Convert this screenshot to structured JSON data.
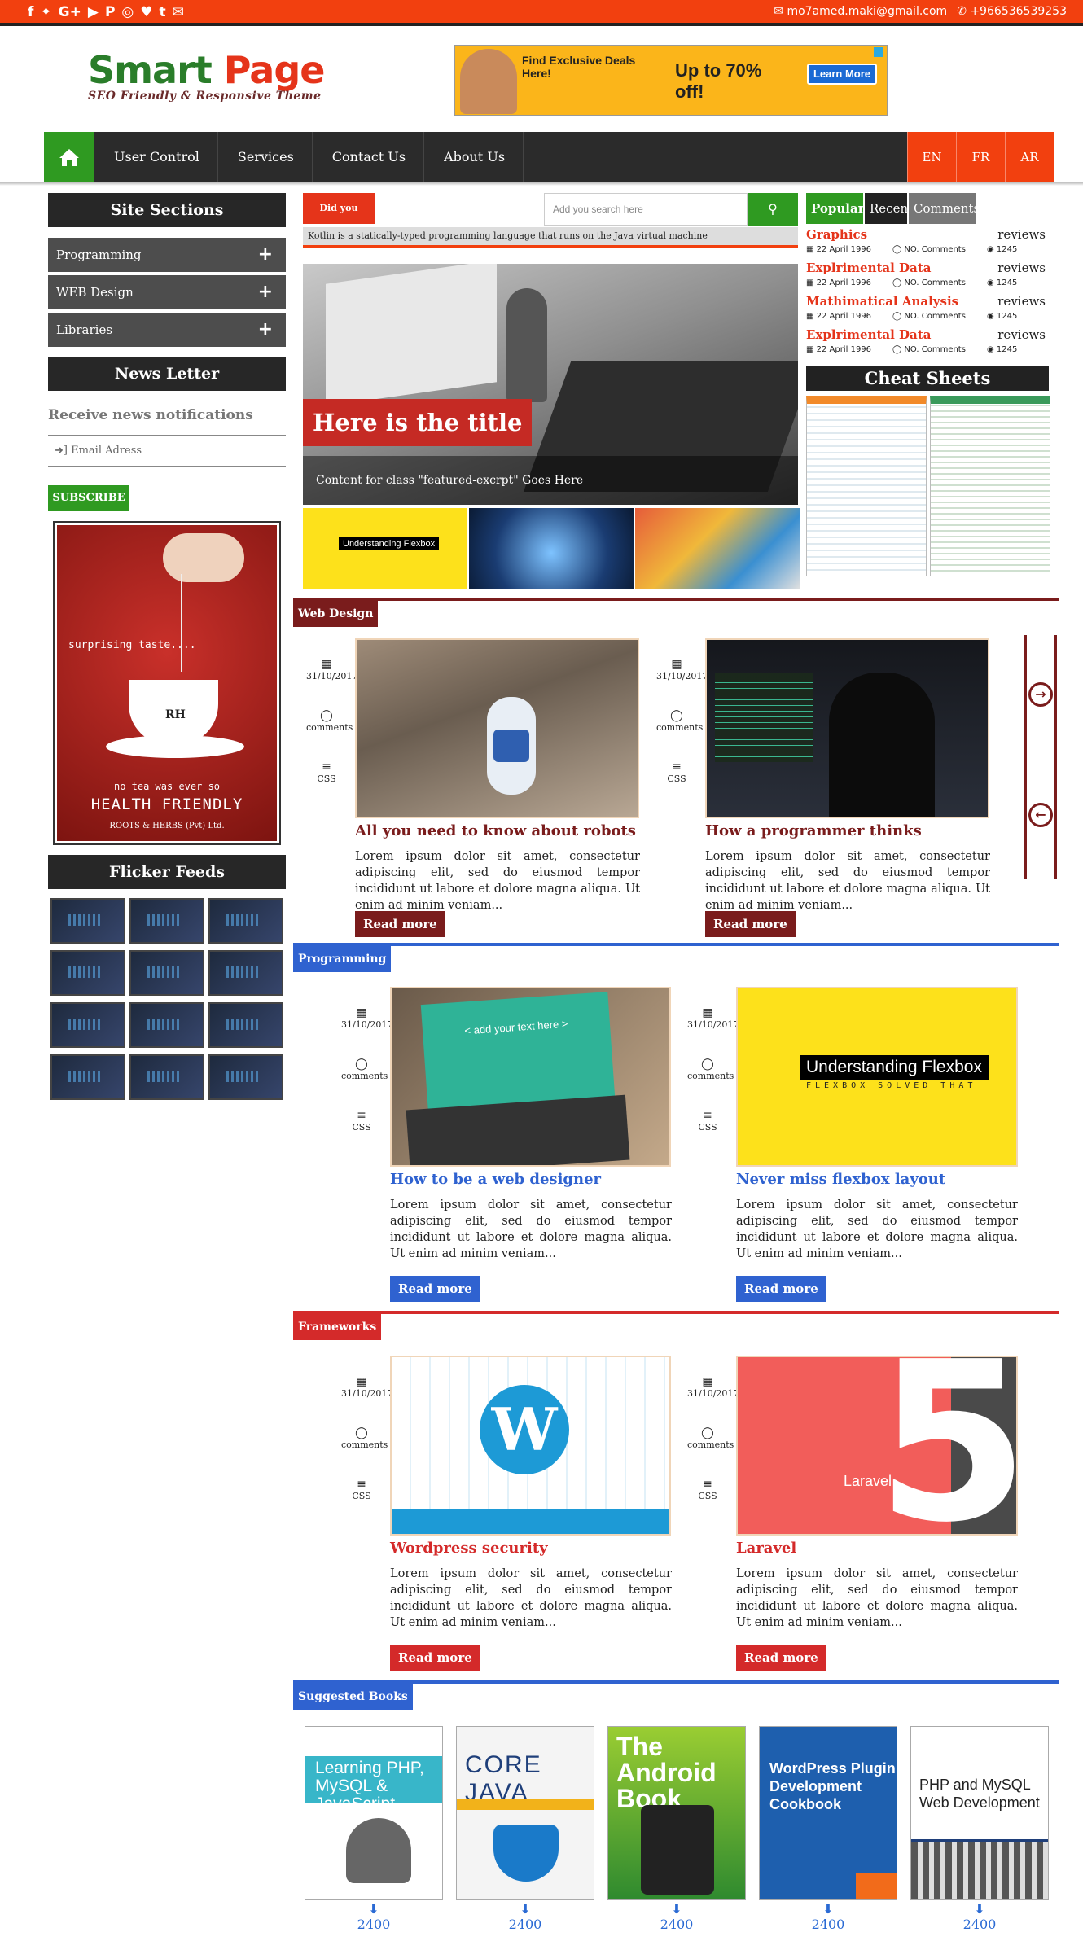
{
  "topbar": {
    "social_icons": [
      "facebook-icon",
      "twitter-icon",
      "google-plus-icon",
      "youtube-icon",
      "pinterest-icon",
      "instagram-icon",
      "heart-icon",
      "tumblr-icon",
      "envelope-icon"
    ],
    "social_glyphs": [
      "f",
      "✦",
      "G+",
      "▶",
      "P",
      "◎",
      "♥",
      "t",
      "✉"
    ],
    "email": "mo7amed.maki@gmail.com",
    "phone": "+966536539253",
    "bg_color": "#f2400f"
  },
  "header": {
    "logo_word1": "Smart",
    "logo_word2": "Page",
    "tagline": "SEO Friendly & Responsive Theme",
    "ad": {
      "line1": "Find Exclusive Deals Here!",
      "line2": "Up to 70% off!",
      "button": "Learn More"
    }
  },
  "nav": {
    "home_icon": "home-icon",
    "items": [
      "User Control",
      "Services",
      "Contact Us",
      "About Us"
    ],
    "languages": [
      "EN",
      "FR",
      "AR"
    ]
  },
  "sidebar": {
    "sections_title": "Site Sections",
    "sections": [
      "Programming",
      "WEB Design",
      "Libraries"
    ],
    "newsletter_title": "News Letter",
    "newsletter_text": "Receive news notifications",
    "email_placeholder": "Email Adress",
    "subscribe_label": "SUBSCRIBE",
    "ad": {
      "tagline": "surprising taste....",
      "line1": "no tea was ever so",
      "line2": "HEALTH FRIENDLY",
      "brand": "ROOTS & HERBS (Pvt) Ltd.",
      "mark": "RH"
    },
    "flicker_title": "Flicker Feeds",
    "flicker_count": 12
  },
  "center": {
    "did_you_know": "Did you Know!",
    "search_placeholder": "Add you search here",
    "ticker": "Kotlin is a statically-typed programming language that runs on the Java virtual machine",
    "featured_title": "Here is the title",
    "featured_excerpt": "Content for class \"featured-excrpt\" Goes Here",
    "thumb1_label": "Understanding Flexbox"
  },
  "right": {
    "tabs": [
      "Popular",
      "Recent",
      "Comments"
    ],
    "popular": [
      {
        "title": "Graphics",
        "reviews": "reviews",
        "date": "22 April 1996",
        "comments": "NO. Comments",
        "views": "1245"
      },
      {
        "title": "Explrimental Data",
        "reviews": "reviews",
        "date": "22 April 1996",
        "comments": "NO. Comments",
        "views": "1245"
      },
      {
        "title": "Mathimatical Analysis",
        "reviews": "reviews",
        "date": "22 April 1996",
        "comments": "NO. Comments",
        "views": "1245"
      },
      {
        "title": "Explrimental Data",
        "reviews": "reviews",
        "date": "22 April 1996",
        "comments": "NO. Comments",
        "views": "1245"
      }
    ],
    "cheat_title": "Cheat Sheets"
  },
  "sections": [
    {
      "tag": "Web Design",
      "color": "#7a1c1c",
      "posts": [
        {
          "date": "31/10/2017",
          "comments": "comments",
          "cat": "CSS",
          "title": "All you need to know about robots",
          "body": "Lorem ipsum dolor sit amet, consectetur adipiscing elit, sed do eiusmod tempor incididunt ut labore et dolore magna aliqua. Ut enim ad minim veniam...",
          "button": "Read more"
        },
        {
          "date": "31/10/2017",
          "comments": "comments",
          "cat": "CSS",
          "title": "How a programmer thinks",
          "body": "Lorem ipsum dolor sit amet, consectetur adipiscing elit, sed do eiusmod tempor incididunt ut labore et dolore magna aliqua. Ut enim ad minim veniam...",
          "button": "Read more"
        }
      ]
    },
    {
      "tag": "Programming",
      "color": "#2f62d0",
      "posts": [
        {
          "date": "31/10/2017",
          "comments": "comments",
          "cat": "CSS",
          "title": "How to be a web designer",
          "body": "Lorem ipsum dolor sit amet, consectetur adipiscing elit, sed do eiusmod tempor incididunt ut labore et dolore magna aliqua. Ut enim ad minim veniam...",
          "button": "Read more",
          "image_text": "< add your text here >"
        },
        {
          "date": "31/10/2017",
          "comments": "comments",
          "cat": "CSS",
          "title": "Never miss flexbox layout",
          "body": "Lorem ipsum dolor sit amet, consectetur adipiscing elit, sed do eiusmod tempor incididunt ut labore et dolore magna aliqua. Ut enim ad minim veniam...",
          "button": "Read more",
          "image_text": "Understanding Flexbox",
          "image_sub": "FLEXBOX SOLVED THAT"
        }
      ]
    },
    {
      "tag": "Frameworks",
      "color": "#d42a2a",
      "posts": [
        {
          "date": "31/10/2017",
          "comments": "comments",
          "cat": "CSS",
          "title": "Wordpress security",
          "body": "Lorem ipsum dolor sit amet, consectetur adipiscing elit, sed do eiusmod tempor incididunt ut labore et dolore magna aliqua. Ut enim ad minim veniam...",
          "button": "Read more",
          "image_text": "W"
        },
        {
          "date": "31/10/2017",
          "comments": "comments",
          "cat": "CSS",
          "title": "Laravel",
          "body": "Lorem ipsum dolor sit amet, consectetur adipiscing elit, sed do eiusmod tempor incididunt ut labore et dolore magna aliqua. Ut enim ad minim veniam...",
          "button": "Read more",
          "image_text": "Laravel",
          "image_num": "5"
        }
      ]
    }
  ],
  "books": {
    "title": "Suggested Books",
    "color": "#2f62d0",
    "items": [
      {
        "cover": "Learning PHP, MySQL & JavaScript",
        "count": "2400"
      },
      {
        "cover": "CORE JAVA",
        "count": "2400"
      },
      {
        "cover": "The Android Book",
        "count": "2400"
      },
      {
        "cover": "WordPress Plugin Development Cookbook",
        "count": "2400"
      },
      {
        "cover": "PHP and MySQL Web Development",
        "count": "2400"
      }
    ]
  }
}
